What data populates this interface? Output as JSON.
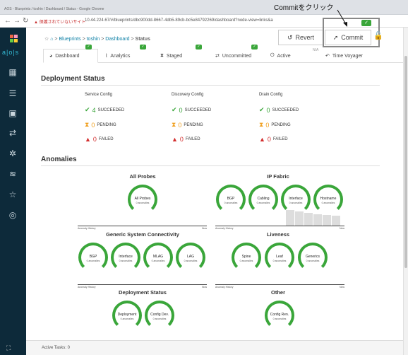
{
  "browser": {
    "title": "AOS - Blueprints / toshin / Dashboard / Status - Google Chrome",
    "security_warning": "▲ 保護されていないサイト",
    "url": "10.44.224.67/#/blueprints/dbc900dd-8667-4db5-89cb-bc5e84792269/dashboard?node-view=links&a"
  },
  "annotation": "Commitをクリック",
  "sidebar": {
    "brand": "a|o|s"
  },
  "breadcrumb": {
    "items": [
      "Blueprints",
      "toshin",
      "Dashboard",
      "Status"
    ],
    "sep": ">"
  },
  "toolbar": {
    "revert": "Revert",
    "commit": "Commit",
    "na": "N/A"
  },
  "tabs": [
    {
      "label": "Dashboard"
    },
    {
      "label": "Analytics"
    },
    {
      "label": "Staged"
    },
    {
      "label": "Uncommitted"
    },
    {
      "label": "Active"
    },
    {
      "label": "Time Voyager"
    }
  ],
  "deployment": {
    "title": "Deployment Status",
    "columns": [
      {
        "title": "Service Config",
        "succeeded": "4",
        "pending": "0",
        "failed": "0"
      },
      {
        "title": "Discovery Config",
        "succeeded": "0",
        "pending": "0",
        "failed": "0"
      },
      {
        "title": "Drain Config",
        "succeeded": "0",
        "pending": "0",
        "failed": "0"
      }
    ],
    "labels": {
      "succeeded": "SUCCEEDED",
      "pending": "PENDING",
      "failed": "FAILED"
    }
  },
  "anomalies": {
    "title": "Anomalies",
    "sub": "0 anomalies",
    "history": "Anomaly History",
    "now": "Now",
    "groups": [
      {
        "title": "All Probes",
        "items": [
          "All Probes"
        ]
      },
      {
        "title": "IP Fabric",
        "items": [
          "BGP",
          "Cabling",
          "Interface",
          "Hostname"
        ]
      },
      {
        "title": "Generic System Connectivity",
        "items": [
          "BGP",
          "Interface",
          "MLAG",
          "LAG"
        ]
      },
      {
        "title": "Liveness",
        "items": [
          "Spine",
          "Leaf",
          "Generics"
        ]
      },
      {
        "title": "Deployment Status",
        "items": [
          "Deployment",
          "Config Dev."
        ]
      },
      {
        "title": "Other",
        "items": [
          "Config Ren."
        ]
      }
    ]
  },
  "footer": {
    "active_tasks": "Active Tasks: 0"
  },
  "colors": {
    "success": "#3aa63a",
    "pending": "#f0a020",
    "failed": "#d32f2f",
    "sidebar": "#0d2a3a",
    "accent": "#35bcd6"
  }
}
